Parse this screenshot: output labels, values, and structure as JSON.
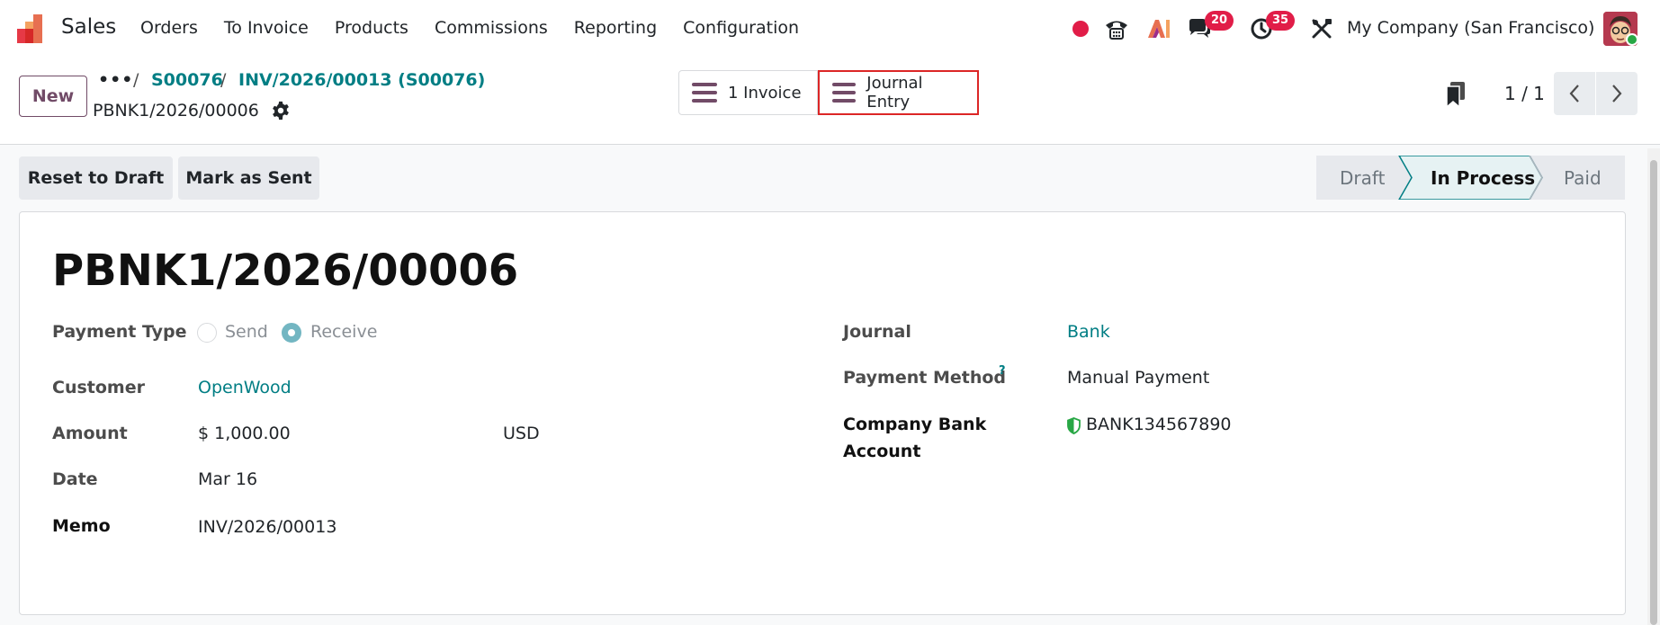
{
  "app": {
    "name": "Sales"
  },
  "menu": [
    "Orders",
    "To Invoice",
    "Products",
    "Commissions",
    "Reporting",
    "Configuration"
  ],
  "systray": {
    "messages_count": "20",
    "activities_count": "35",
    "company": "My Company (San Francisco)"
  },
  "control": {
    "new_label": "New",
    "breadcrumbs": [
      "S00076",
      "INV/2026/00013 (S00076)"
    ],
    "record_name": "PBNK1/2026/00006",
    "smart_buttons": [
      "1 Invoice",
      "Journal Entry"
    ],
    "pager": "1 / 1"
  },
  "actions": [
    "Reset to Draft",
    "Mark as Sent"
  ],
  "statusbar": {
    "stages": [
      "Draft",
      "In Process",
      "Paid"
    ],
    "active": "In Process"
  },
  "form": {
    "title": "PBNK1/2026/00006",
    "payment_type": {
      "label": "Payment Type",
      "options": [
        "Send",
        "Receive"
      ],
      "selected": "Receive"
    },
    "customer": {
      "label": "Customer",
      "value": "OpenWood"
    },
    "amount": {
      "label": "Amount",
      "value": "$ 1,000.00",
      "currency": "USD"
    },
    "date": {
      "label": "Date",
      "value": "Mar 16"
    },
    "memo": {
      "label": "Memo",
      "value": "INV/2026/00013"
    },
    "journal": {
      "label": "Journal",
      "value": "Bank"
    },
    "payment_method": {
      "label": "Payment Method",
      "help": "?",
      "value": "Manual Payment"
    },
    "company_bank_account": {
      "label_line1": "Company Bank",
      "label_line2": "Account",
      "value": "BANK134567890"
    }
  },
  "colors": {
    "brand": "#714b67",
    "link": "#017e84",
    "badge": "#e11d48",
    "highlight": "#dc2626",
    "active_stage": "#e6f2f3"
  }
}
